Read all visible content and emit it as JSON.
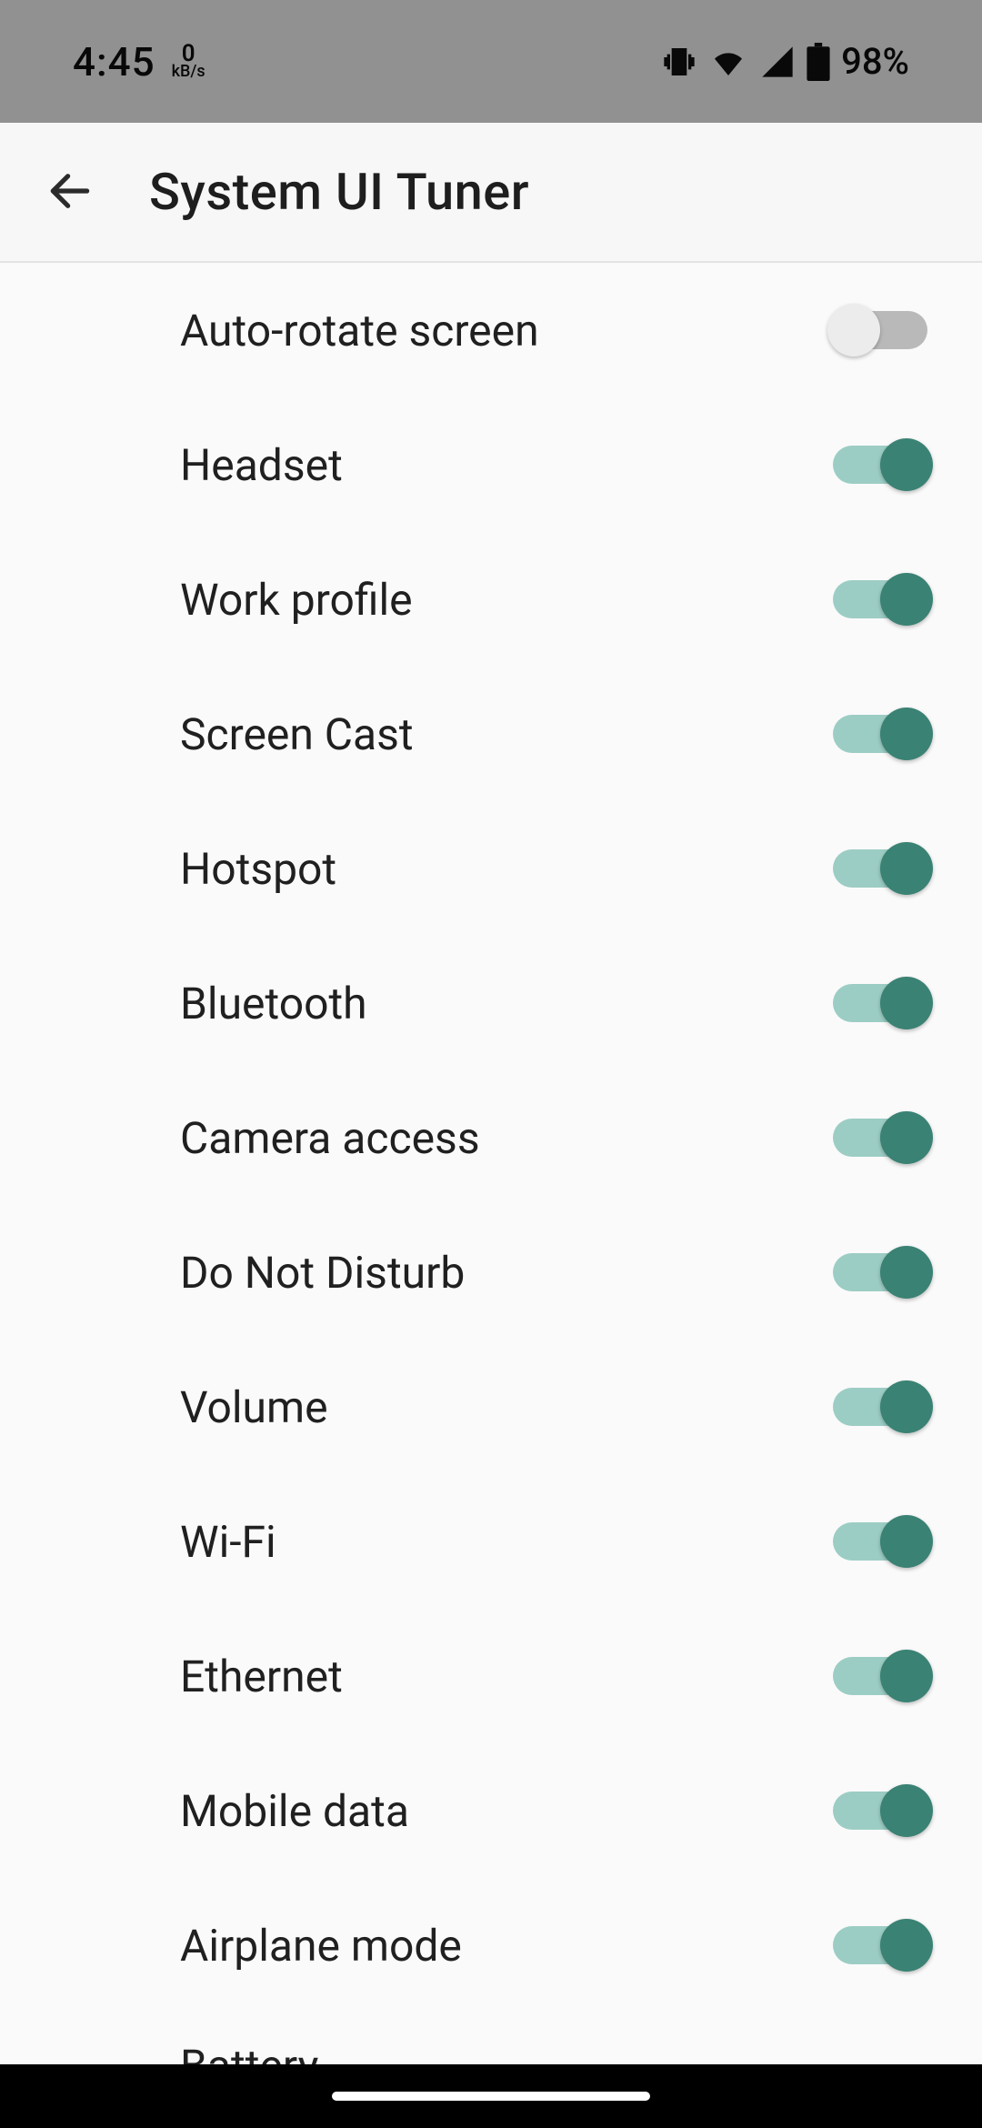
{
  "status_bar": {
    "time": "4:45",
    "net_top": "0",
    "net_bot": "kB/s",
    "battery": "98%"
  },
  "header": {
    "title": "System UI Tuner"
  },
  "toggle_color_on_track": "#9ccdc4",
  "toggle_color_on_thumb": "#3a8274",
  "toggle_color_off_track": "#b9b9b9",
  "toggle_color_off_thumb": "#ececec",
  "items": [
    {
      "label": "Auto-rotate screen",
      "on": false
    },
    {
      "label": "Headset",
      "on": true
    },
    {
      "label": "Work profile",
      "on": true
    },
    {
      "label": "Screen Cast",
      "on": true
    },
    {
      "label": "Hotspot",
      "on": true
    },
    {
      "label": "Bluetooth",
      "on": true
    },
    {
      "label": "Camera access",
      "on": true
    },
    {
      "label": "Do Not Disturb",
      "on": true
    },
    {
      "label": "Volume",
      "on": true
    },
    {
      "label": "Wi-Fi",
      "on": true
    },
    {
      "label": "Ethernet",
      "on": true
    },
    {
      "label": "Mobile data",
      "on": true
    },
    {
      "label": "Airplane mode",
      "on": true
    }
  ],
  "partial_item": {
    "label": "Battery"
  }
}
